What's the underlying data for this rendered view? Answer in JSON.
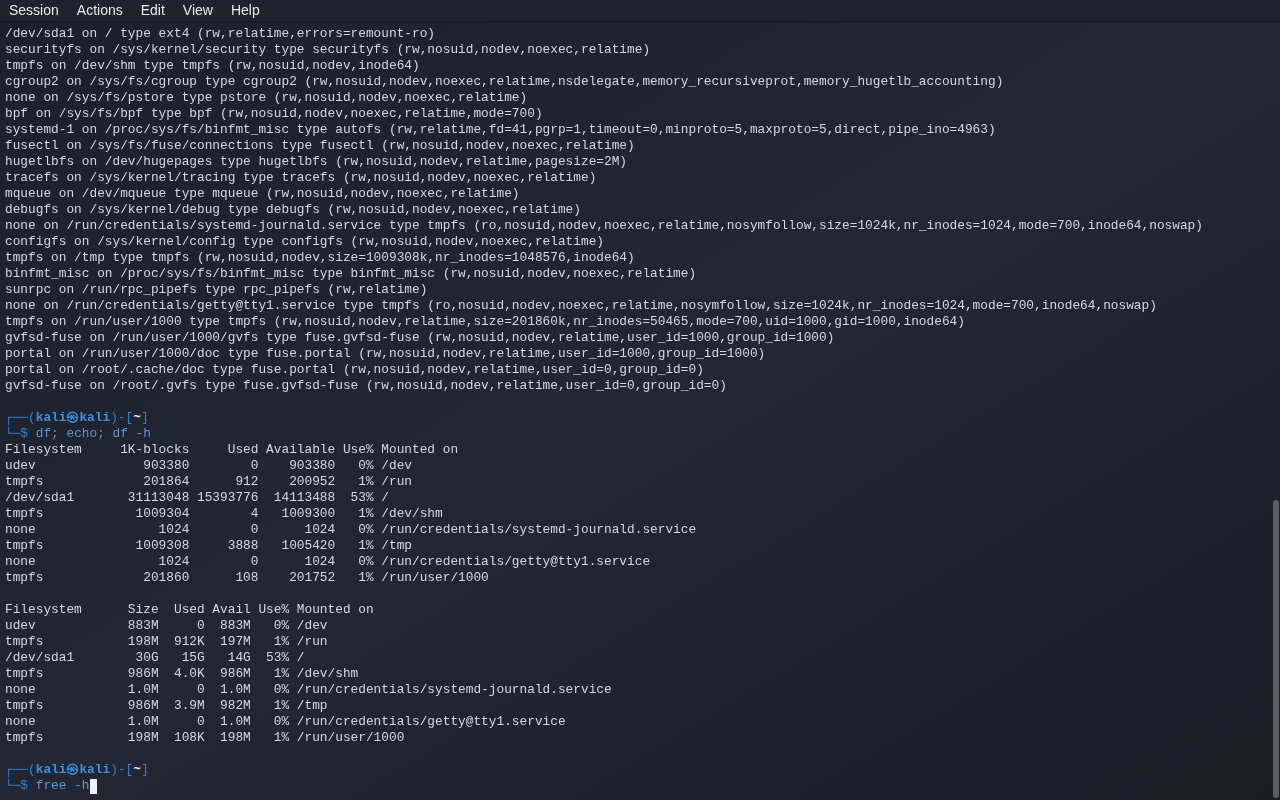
{
  "menu": [
    "Session",
    "Actions",
    "Edit",
    "View",
    "Help"
  ],
  "terminal": {
    "blocks": [
      {
        "kind": "output",
        "lines": [
          "/dev/sda1 on / type ext4 (rw,relatime,errors=remount-ro)",
          "securityfs on /sys/kernel/security type securityfs (rw,nosuid,nodev,noexec,relatime)",
          "tmpfs on /dev/shm type tmpfs (rw,nosuid,nodev,inode64)",
          "cgroup2 on /sys/fs/cgroup type cgroup2 (rw,nosuid,nodev,noexec,relatime,nsdelegate,memory_recursiveprot,memory_hugetlb_accounting)",
          "none on /sys/fs/pstore type pstore (rw,nosuid,nodev,noexec,relatime)",
          "bpf on /sys/fs/bpf type bpf (rw,nosuid,nodev,noexec,relatime,mode=700)",
          "systemd-1 on /proc/sys/fs/binfmt_misc type autofs (rw,relatime,fd=41,pgrp=1,timeout=0,minproto=5,maxproto=5,direct,pipe_ino=4963)",
          "fusectl on /sys/fs/fuse/connections type fusectl (rw,nosuid,nodev,noexec,relatime)",
          "hugetlbfs on /dev/hugepages type hugetlbfs (rw,nosuid,nodev,relatime,pagesize=2M)",
          "tracefs on /sys/kernel/tracing type tracefs (rw,nosuid,nodev,noexec,relatime)",
          "mqueue on /dev/mqueue type mqueue (rw,nosuid,nodev,noexec,relatime)",
          "debugfs on /sys/kernel/debug type debugfs (rw,nosuid,nodev,noexec,relatime)",
          "none on /run/credentials/systemd-journald.service type tmpfs (ro,nosuid,nodev,noexec,relatime,nosymfollow,size=1024k,nr_inodes=1024,mode=700,inode64,noswap)",
          "configfs on /sys/kernel/config type configfs (rw,nosuid,nodev,noexec,relatime)",
          "tmpfs on /tmp type tmpfs (rw,nosuid,nodev,size=1009308k,nr_inodes=1048576,inode64)",
          "binfmt_misc on /proc/sys/fs/binfmt_misc type binfmt_misc (rw,nosuid,nodev,noexec,relatime)",
          "sunrpc on /run/rpc_pipefs type rpc_pipefs (rw,relatime)",
          "none on /run/credentials/getty@tty1.service type tmpfs (ro,nosuid,nodev,noexec,relatime,nosymfollow,size=1024k,nr_inodes=1024,mode=700,inode64,noswap)",
          "tmpfs on /run/user/1000 type tmpfs (rw,nosuid,nodev,relatime,size=201860k,nr_inodes=50465,mode=700,uid=1000,gid=1000,inode64)",
          "gvfsd-fuse on /run/user/1000/gvfs type fuse.gvfsd-fuse (rw,nosuid,nodev,relatime,user_id=1000,group_id=1000)",
          "portal on /run/user/1000/doc type fuse.portal (rw,nosuid,nodev,relatime,user_id=1000,group_id=1000)",
          "portal on /root/.cache/doc type fuse.portal (rw,nosuid,nodev,relatime,user_id=0,group_id=0)",
          "gvfsd-fuse on /root/.gvfs type fuse.gvfsd-fuse (rw,nosuid,nodev,relatime,user_id=0,group_id=0)"
        ]
      },
      {
        "kind": "prompt",
        "frame_top": "┌──(",
        "user_host": "kali㉿kali",
        "separator": ")-[",
        "dir": "~",
        "close": "]",
        "frame_bottom": "└─$",
        "command": "df; echo; df -h",
        "cursor": false
      },
      {
        "kind": "output",
        "lines": [
          "Filesystem     1K-blocks     Used Available Use% Mounted on",
          "udev              903380        0    903380   0% /dev",
          "tmpfs             201864      912    200952   1% /run",
          "/dev/sda1       31113048 15393776  14113488  53% /",
          "tmpfs            1009304        4   1009300   1% /dev/shm",
          "none                1024        0      1024   0% /run/credentials/systemd-journald.service",
          "tmpfs            1009308     3888   1005420   1% /tmp",
          "none                1024        0      1024   0% /run/credentials/getty@tty1.service",
          "tmpfs             201860      108    201752   1% /run/user/1000"
        ]
      },
      {
        "kind": "output",
        "lines": [
          "Filesystem      Size  Used Avail Use% Mounted on",
          "udev            883M     0  883M   0% /dev",
          "tmpfs           198M  912K  197M   1% /run",
          "/dev/sda1        30G   15G   14G  53% /",
          "tmpfs           986M  4.0K  986M   1% /dev/shm",
          "none            1.0M     0  1.0M   0% /run/credentials/systemd-journald.service",
          "tmpfs           986M  3.9M  982M   1% /tmp",
          "none            1.0M     0  1.0M   0% /run/credentials/getty@tty1.service",
          "tmpfs           198M  108K  198M   1% /run/user/1000"
        ]
      },
      {
        "kind": "prompt",
        "frame_top": "┌──(",
        "user_host": "kali㉿kali",
        "separator": ")-[",
        "dir": "~",
        "close": "]",
        "frame_bottom": "└─$",
        "command": "free -h",
        "cursor": true
      }
    ]
  }
}
